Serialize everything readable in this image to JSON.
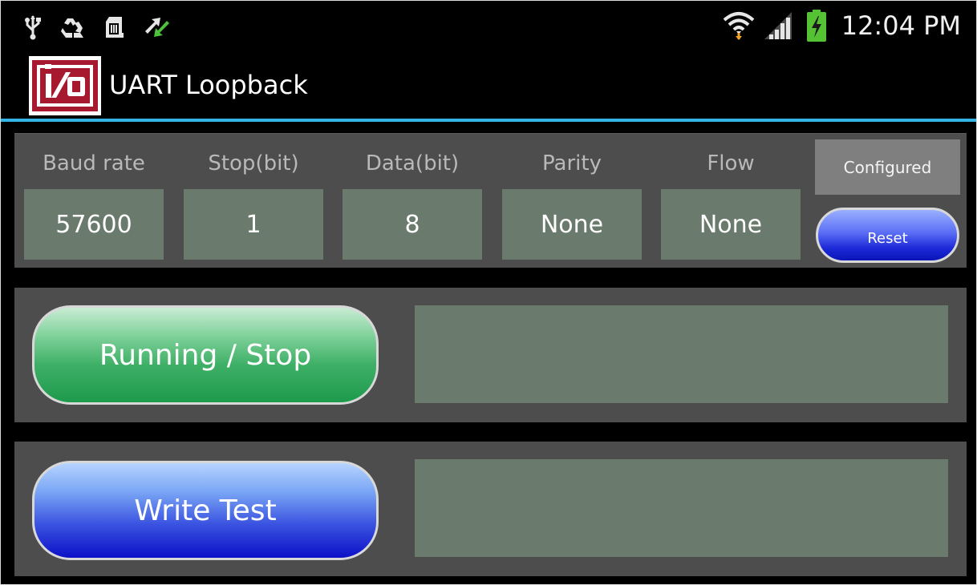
{
  "status_bar": {
    "time": "12:04 PM",
    "icons_left": [
      "usb-icon",
      "recycle-icon",
      "sd-card-icon",
      "sync-arrows-icon"
    ],
    "icons_right": [
      "wifi-icon",
      "signal-icon",
      "battery-charging-icon"
    ]
  },
  "action_bar": {
    "title": "UART Loopback",
    "logo_icon": "io-logo-icon",
    "divider_color": "#33b5e5"
  },
  "config": {
    "columns": [
      {
        "label": "Baud rate",
        "value": "57600"
      },
      {
        "label": "Stop(bit)",
        "value": "1"
      },
      {
        "label": "Data(bit)",
        "value": "8"
      },
      {
        "label": "Parity",
        "value": "None"
      },
      {
        "label": "Flow",
        "value": "None"
      }
    ],
    "configured_label": "Configured",
    "reset_label": "Reset"
  },
  "run": {
    "button_label": "Running / Stop",
    "output_text": ""
  },
  "write": {
    "button_label": "Write Test",
    "output_text": ""
  },
  "colors": {
    "panel": "#4d4d4d",
    "field": "#6a7a6c",
    "accent": "#33b5e5",
    "run_button": "#1d9a4b",
    "write_button": "#0c10c8"
  }
}
